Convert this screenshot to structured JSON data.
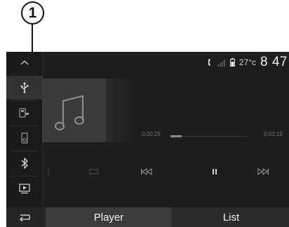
{
  "callout": {
    "label": "1"
  },
  "status": {
    "temperature": "27°c",
    "clock": "8 47"
  },
  "sidebar": {
    "items": [
      {
        "icon": "chevron-up-icon"
      },
      {
        "icon": "usb-icon",
        "active": true
      },
      {
        "icon": "aux-source-icon"
      },
      {
        "icon": "media-player-icon"
      },
      {
        "icon": "bluetooth-icon"
      },
      {
        "icon": "screen-icon"
      }
    ]
  },
  "player": {
    "elapsed": "0:00:29",
    "duration": "0:03:15",
    "progress_fraction": 0.15,
    "controls": [
      "shuffle-icon",
      "repeat-icon",
      "previous-track-icon",
      "pause-icon",
      "next-track-icon"
    ]
  },
  "tabs": {
    "player": "Player",
    "list": "List"
  },
  "colors": {
    "screen_bg": "#1d1d1d",
    "active_tab": "#3b3b3b",
    "text": "#f2f2f2"
  }
}
